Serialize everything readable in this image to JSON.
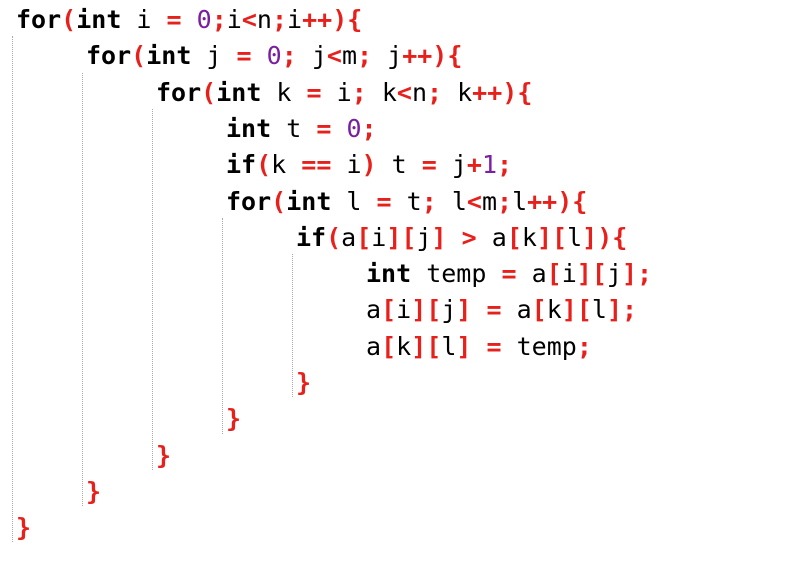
{
  "editor": {
    "colors": {
      "keyword": "#000000",
      "punctuation": "#e8201c",
      "number": "#7a1fa2",
      "identifier": "#000000",
      "indent_guide": "#a9a9a9",
      "background": "#ffffff"
    },
    "lines": [
      {
        "indent": 0,
        "tokens": [
          [
            "kw",
            "for"
          ],
          [
            "p",
            "("
          ],
          [
            "kw",
            "int"
          ],
          [
            "t",
            " i "
          ],
          [
            "op",
            "="
          ],
          [
            "t",
            " "
          ],
          [
            "num",
            "0"
          ],
          [
            "p",
            ";"
          ],
          [
            "t",
            "i"
          ],
          [
            "op",
            "<"
          ],
          [
            "t",
            "n"
          ],
          [
            "p",
            ";"
          ],
          [
            "t",
            "i"
          ],
          [
            "op",
            "++"
          ],
          [
            "p",
            ")"
          ],
          [
            "p",
            "{"
          ]
        ]
      },
      {
        "indent": 1,
        "tokens": [
          [
            "kw",
            "for"
          ],
          [
            "p",
            "("
          ],
          [
            "kw",
            "int"
          ],
          [
            "t",
            " j "
          ],
          [
            "op",
            "="
          ],
          [
            "t",
            " "
          ],
          [
            "num",
            "0"
          ],
          [
            "p",
            ";"
          ],
          [
            "t",
            " j"
          ],
          [
            "op",
            "<"
          ],
          [
            "t",
            "m"
          ],
          [
            "p",
            ";"
          ],
          [
            "t",
            " j"
          ],
          [
            "op",
            "++"
          ],
          [
            "p",
            ")"
          ],
          [
            "p",
            "{"
          ]
        ]
      },
      {
        "indent": 2,
        "tokens": [
          [
            "kw",
            "for"
          ],
          [
            "p",
            "("
          ],
          [
            "kw",
            "int"
          ],
          [
            "t",
            " k "
          ],
          [
            "op",
            "="
          ],
          [
            "t",
            " i"
          ],
          [
            "p",
            ";"
          ],
          [
            "t",
            " k"
          ],
          [
            "op",
            "<"
          ],
          [
            "t",
            "n"
          ],
          [
            "p",
            ";"
          ],
          [
            "t",
            " k"
          ],
          [
            "op",
            "++"
          ],
          [
            "p",
            ")"
          ],
          [
            "p",
            "{"
          ]
        ]
      },
      {
        "indent": 3,
        "tokens": [
          [
            "kw",
            "int"
          ],
          [
            "t",
            " t "
          ],
          [
            "op",
            "="
          ],
          [
            "t",
            " "
          ],
          [
            "num",
            "0"
          ],
          [
            "p",
            ";"
          ]
        ]
      },
      {
        "indent": 3,
        "tokens": [
          [
            "kw",
            "if"
          ],
          [
            "p",
            "("
          ],
          [
            "t",
            "k "
          ],
          [
            "op",
            "=="
          ],
          [
            "t",
            " i"
          ],
          [
            "p",
            ")"
          ],
          [
            "t",
            " t "
          ],
          [
            "op",
            "="
          ],
          [
            "t",
            " j"
          ],
          [
            "op",
            "+"
          ],
          [
            "num",
            "1"
          ],
          [
            "p",
            ";"
          ]
        ]
      },
      {
        "indent": 3,
        "tokens": [
          [
            "kw",
            "for"
          ],
          [
            "p",
            "("
          ],
          [
            "kw",
            "int"
          ],
          [
            "t",
            " l "
          ],
          [
            "op",
            "="
          ],
          [
            "t",
            " t"
          ],
          [
            "p",
            ";"
          ],
          [
            "t",
            " l"
          ],
          [
            "op",
            "<"
          ],
          [
            "t",
            "m"
          ],
          [
            "p",
            ";"
          ],
          [
            "t",
            "l"
          ],
          [
            "op",
            "++"
          ],
          [
            "p",
            ")"
          ],
          [
            "p",
            "{"
          ]
        ]
      },
      {
        "indent": 4,
        "tokens": [
          [
            "kw",
            "if"
          ],
          [
            "p",
            "("
          ],
          [
            "t",
            "a"
          ],
          [
            "p",
            "["
          ],
          [
            "t",
            "i"
          ],
          [
            "p",
            "]"
          ],
          [
            "p",
            "["
          ],
          [
            "t",
            "j"
          ],
          [
            "p",
            "]"
          ],
          [
            "t",
            " "
          ],
          [
            "op",
            ">"
          ],
          [
            "t",
            " a"
          ],
          [
            "p",
            "["
          ],
          [
            "t",
            "k"
          ],
          [
            "p",
            "]"
          ],
          [
            "p",
            "["
          ],
          [
            "t",
            "l"
          ],
          [
            "p",
            "]"
          ],
          [
            "p",
            ")"
          ],
          [
            "p",
            "{"
          ]
        ]
      },
      {
        "indent": 5,
        "tokens": [
          [
            "kw",
            "int"
          ],
          [
            "t",
            " temp "
          ],
          [
            "op",
            "="
          ],
          [
            "t",
            " a"
          ],
          [
            "p",
            "["
          ],
          [
            "t",
            "i"
          ],
          [
            "p",
            "]"
          ],
          [
            "p",
            "["
          ],
          [
            "t",
            "j"
          ],
          [
            "p",
            "]"
          ],
          [
            "p",
            ";"
          ]
        ]
      },
      {
        "indent": 5,
        "tokens": [
          [
            "t",
            "a"
          ],
          [
            "p",
            "["
          ],
          [
            "t",
            "i"
          ],
          [
            "p",
            "]"
          ],
          [
            "p",
            "["
          ],
          [
            "t",
            "j"
          ],
          [
            "p",
            "]"
          ],
          [
            "t",
            " "
          ],
          [
            "op",
            "="
          ],
          [
            "t",
            " a"
          ],
          [
            "p",
            "["
          ],
          [
            "t",
            "k"
          ],
          [
            "p",
            "]"
          ],
          [
            "p",
            "["
          ],
          [
            "t",
            "l"
          ],
          [
            "p",
            "]"
          ],
          [
            "p",
            ";"
          ]
        ]
      },
      {
        "indent": 5,
        "tokens": [
          [
            "t",
            "a"
          ],
          [
            "p",
            "["
          ],
          [
            "t",
            "k"
          ],
          [
            "p",
            "]"
          ],
          [
            "p",
            "["
          ],
          [
            "t",
            "l"
          ],
          [
            "p",
            "]"
          ],
          [
            "t",
            " "
          ],
          [
            "op",
            "="
          ],
          [
            "t",
            " temp"
          ],
          [
            "p",
            ";"
          ]
        ]
      },
      {
        "indent": 4,
        "tokens": [
          [
            "p",
            "}"
          ]
        ]
      },
      {
        "indent": 3,
        "tokens": [
          [
            "p",
            "}"
          ]
        ]
      },
      {
        "indent": 2,
        "tokens": [
          [
            "p",
            "}"
          ]
        ]
      },
      {
        "indent": 1,
        "tokens": [
          [
            "p",
            "}"
          ]
        ]
      },
      {
        "indent": 0,
        "tokens": [
          [
            "p",
            "}"
          ]
        ]
      }
    ]
  }
}
